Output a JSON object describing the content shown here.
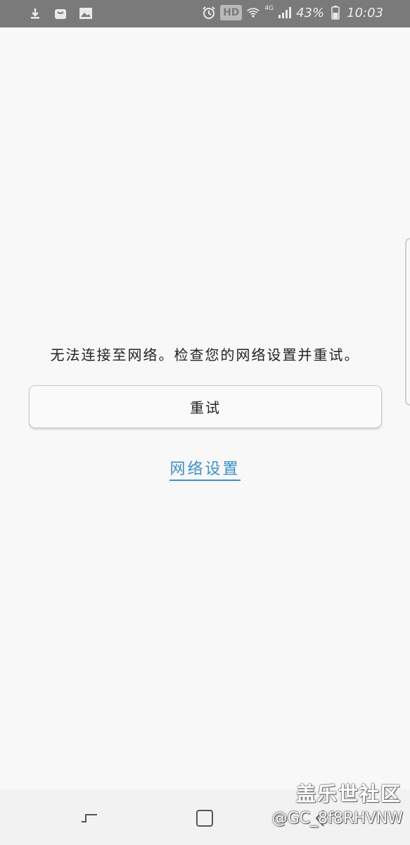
{
  "status_bar": {
    "icons_left": [
      "download-icon",
      "bag-icon",
      "gallery-icon"
    ],
    "hd_label": "HD",
    "network_label": "4G",
    "battery_percent": "43%",
    "time": "10:03"
  },
  "main": {
    "message": "无法连接至网络。检查您的网络设置并重试。",
    "retry_label": "重试",
    "network_settings_label": "网络设置"
  },
  "watermark": {
    "title": "盖乐世社区",
    "user": "@GC_8f8RHVNW"
  },
  "colors": {
    "status_bar_bg": "#7a7a7a",
    "page_bg": "#f8f8f8",
    "link": "#3b8fc6",
    "nav_bar_bg": "#f2f2f2"
  }
}
